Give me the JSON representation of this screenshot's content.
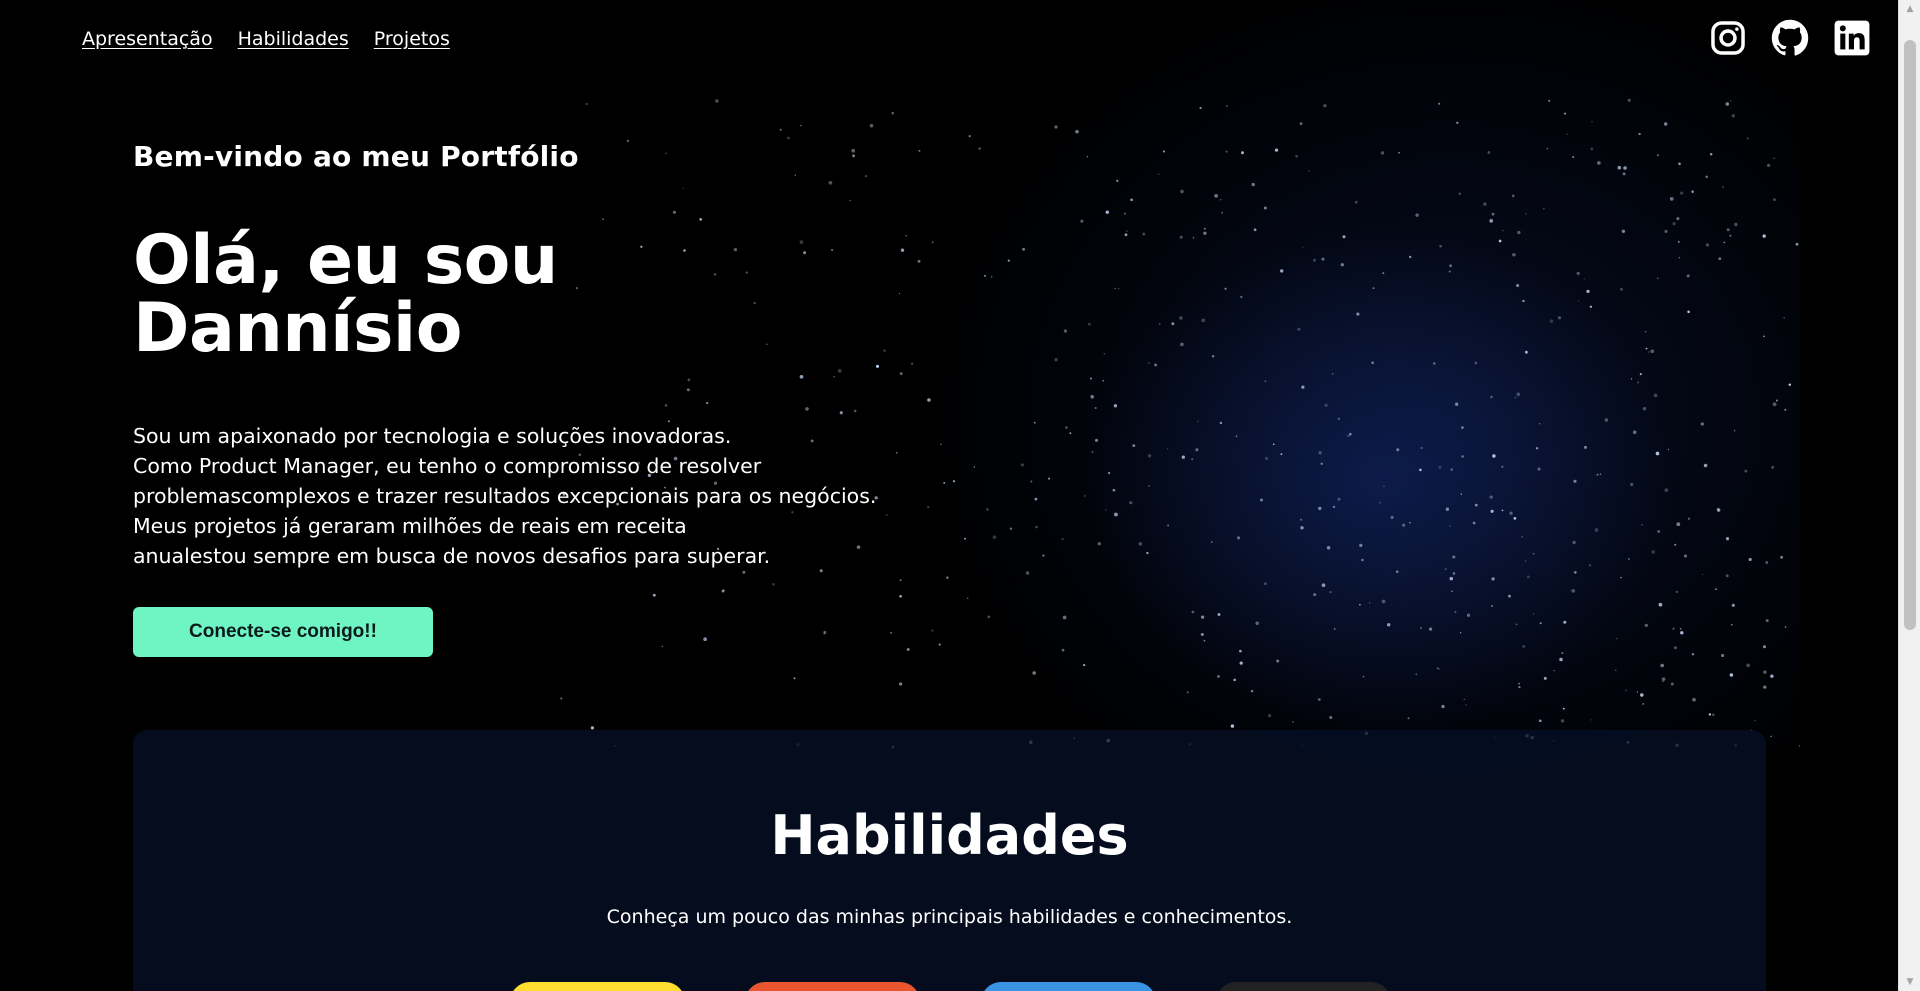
{
  "nav": {
    "links": [
      {
        "label": "Apresentação"
      },
      {
        "label": "Habilidades"
      },
      {
        "label": "Projetos"
      }
    ]
  },
  "socials": [
    {
      "icon": "instagram-icon"
    },
    {
      "icon": "github-icon"
    },
    {
      "icon": "linkedin-icon"
    }
  ],
  "hero": {
    "welcome": "Bem-vindo ao meu Portfólio",
    "headline": "Olá, eu sou Dannísio",
    "bio_lines": [
      "Sou um apaixonado por tecnologia e soluções inovadoras.",
      "Como Product Manager, eu tenho o compromisso de resolver",
      "problemascomplexos e trazer resultados excepcionais para os negócios.",
      "Meus projetos já geraram milhões de reais em receita",
      "anualestou sempre em busca de novos desafios para superar."
    ],
    "cta_label": "Conecte-se comigo!!"
  },
  "skills": {
    "title": "Habilidades",
    "subtitle": "Conheça um pouco das minhas principais habilidades e conhecimentos.",
    "chip_colors": [
      "#ffde2f",
      "#e9552e",
      "#3b93e3",
      "#222222"
    ]
  },
  "colors": {
    "accent": "#6ff5c3",
    "background": "#000000"
  }
}
